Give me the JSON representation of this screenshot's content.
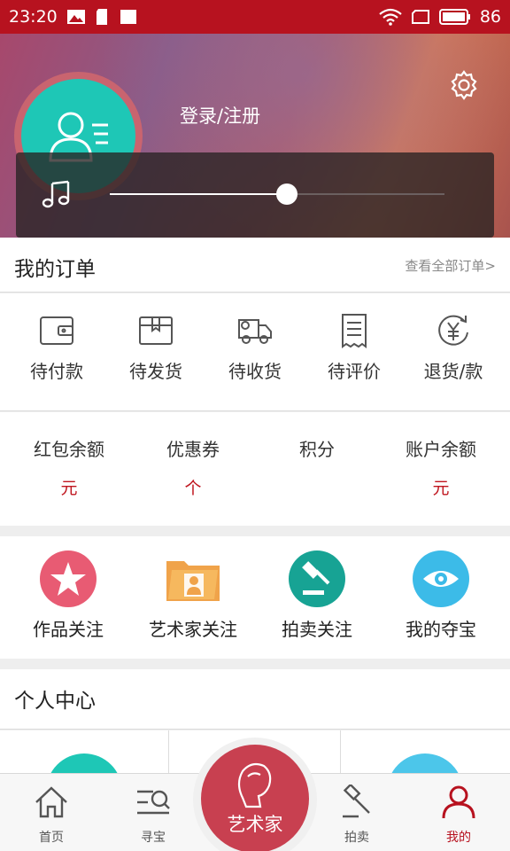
{
  "status_bar": {
    "time": "23:20",
    "battery": "86"
  },
  "header": {
    "login_label": "登录/注册",
    "music_progress": 0.53
  },
  "orders": {
    "title": "我的订单",
    "view_all": "查看全部订单>",
    "items": [
      {
        "label": "待付款",
        "icon": "wallet-icon"
      },
      {
        "label": "待发货",
        "icon": "box-icon"
      },
      {
        "label": "待收货",
        "icon": "truck-icon"
      },
      {
        "label": "待评价",
        "icon": "receipt-icon"
      },
      {
        "label": "退货/款",
        "icon": "refund-icon"
      }
    ]
  },
  "balance": {
    "items": [
      {
        "label": "红包余额",
        "unit": "元"
      },
      {
        "label": "优惠券",
        "unit": "个"
      },
      {
        "label": "积分",
        "unit": ""
      },
      {
        "label": "账户余额",
        "unit": "元"
      }
    ]
  },
  "follows": {
    "items": [
      {
        "label": "作品关注",
        "icon": "star-icon",
        "color": "#e85b73"
      },
      {
        "label": "艺术家关注",
        "icon": "folder-person-icon",
        "color": "#f0a34a"
      },
      {
        "label": "拍卖关注",
        "icon": "gavel-icon",
        "color": "#17a394"
      },
      {
        "label": "我的夺宝",
        "icon": "eye-icon",
        "color": "#3cbbe8"
      }
    ]
  },
  "personal": {
    "title": "个人中心"
  },
  "bottom_nav": {
    "items": [
      {
        "label": "首页",
        "icon": "home-icon"
      },
      {
        "label": "寻宝",
        "icon": "search-list-icon"
      },
      {
        "label": "艺术家",
        "icon": "artist-icon"
      },
      {
        "label": "拍卖",
        "icon": "gavel-icon"
      },
      {
        "label": "我的",
        "icon": "user-icon"
      }
    ]
  },
  "colors": {
    "brand_red": "#b7121f",
    "teal": "#1ec7b6"
  }
}
